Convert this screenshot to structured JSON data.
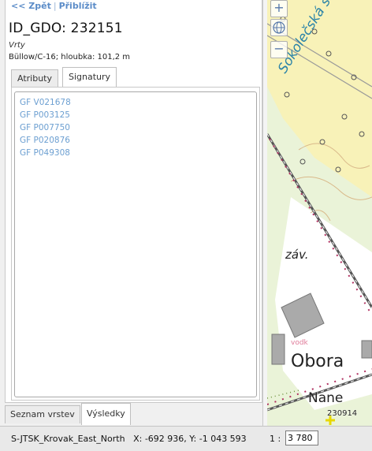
{
  "nav": {
    "back": "<< Zpět",
    "separator": "|",
    "zoom": "Přiblížit"
  },
  "record": {
    "title": "ID_GDO: 232151",
    "type": "Vrty",
    "info": "Büllow/C-16; hloubka: 101,2 m"
  },
  "tabs": [
    {
      "label": "Atributy",
      "active": false
    },
    {
      "label": "Signatury",
      "active": true
    }
  ],
  "signatures": [
    "GF V021678",
    "GF P003125",
    "GF P007750",
    "GF P020876",
    "GF P049308"
  ],
  "bottom_tabs": [
    {
      "label": "Seznam vrstev",
      "active": false
    },
    {
      "label": "Výsledky",
      "active": true
    }
  ],
  "map": {
    "zoom_in": "+",
    "zoom_out": "−",
    "labels": {
      "street": "Sokolečská stro",
      "zav": "záv.",
      "obora": "Obora",
      "nane": "Nane",
      "vody": "vodk",
      "point": "230914"
    }
  },
  "status": {
    "projection": "S-JTSK_Krovak_East_North",
    "coords": "X: -692 936, Y: -1 043 593",
    "scale_label": "1 :",
    "scale_value": "3 780"
  },
  "colors": {
    "link": "#5b8cc8",
    "signature": "#6c9fd1",
    "map_yellow": "#f7f0b0",
    "railway": "#b03060"
  }
}
